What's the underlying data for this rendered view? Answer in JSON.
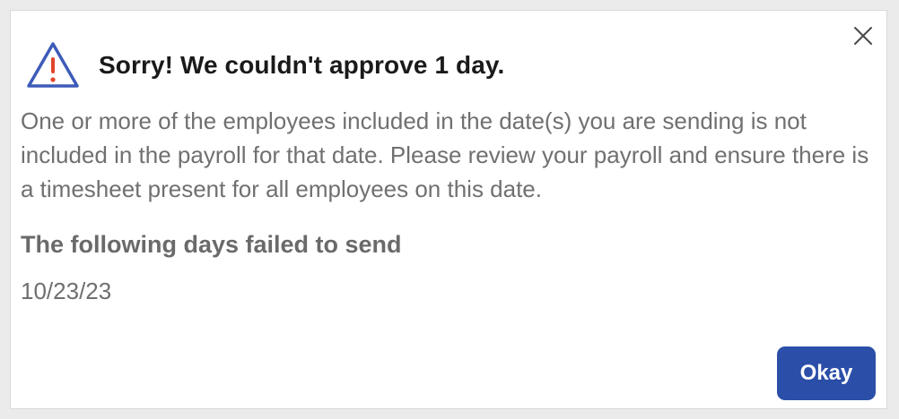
{
  "dialog": {
    "title": "Sorry! We couldn't approve 1 day.",
    "icon": "warning-triangle-icon",
    "close_icon": "close-icon",
    "message": "One or more of the employees included in the date(s) you are sending is not included in the payroll for that date. Please review your payroll and ensure there is a timesheet present for all employees on this date.",
    "section_title": "The following days failed to send",
    "failed_dates": [
      "10/23/23"
    ],
    "okay_label": "Okay"
  },
  "colors": {
    "warning_outline": "#3d5bb8",
    "warning_mark": "#e0462a",
    "primary_button": "#2b4fa8",
    "body_text": "#707070",
    "title_text": "#1a1a1a"
  }
}
